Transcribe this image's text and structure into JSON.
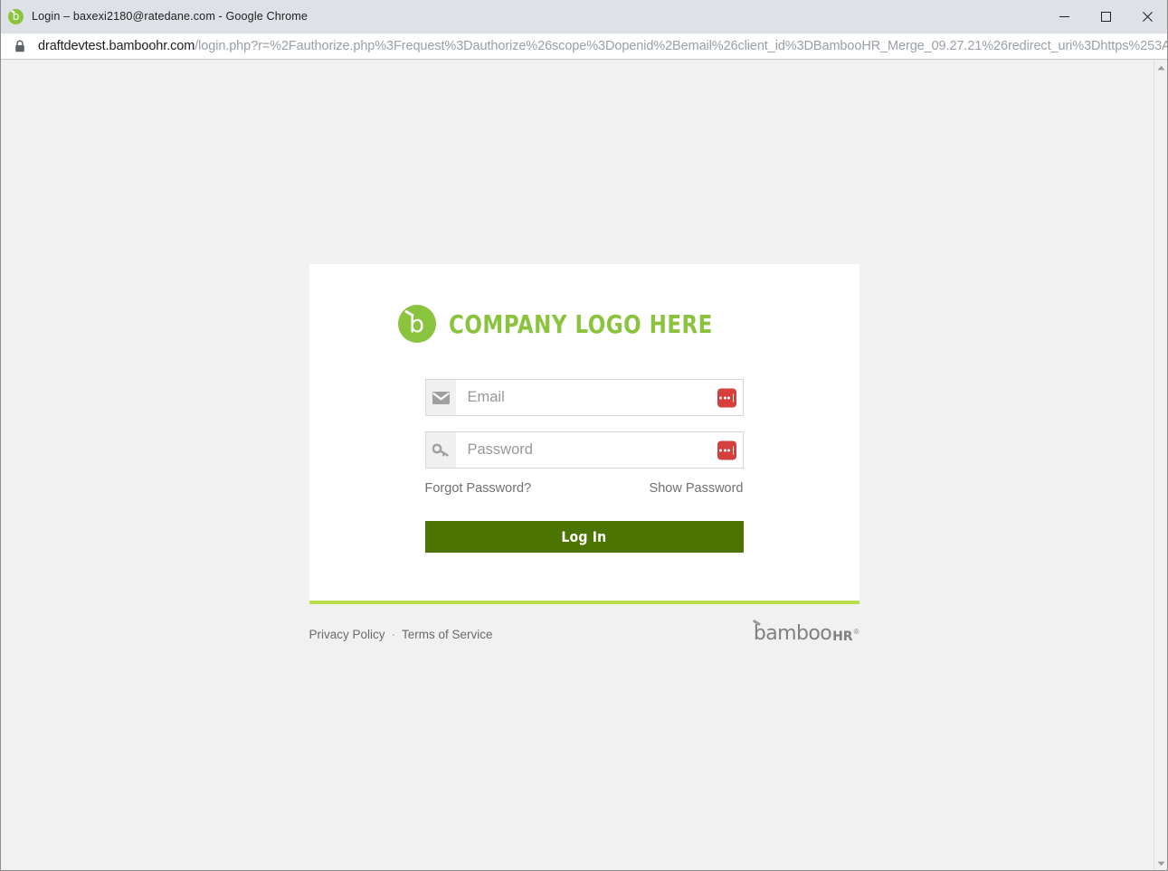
{
  "browser": {
    "window_title": "Login – baxexi2180@ratedane.com - Google Chrome",
    "favicon_name": "bamboohr-favicon",
    "minimize_label": "Minimize",
    "maximize_label": "Maximize",
    "close_label": "Close",
    "url_host": "draftdevtest.bamboohr.com",
    "url_path": "/login.php?r=%2Fauthorize.php%3Frequest%3Dauthorize%26scope%3Dopenid%2Bemail%26client_id%3DBambooHR_Merge_09.27.21%26redirect_uri%3Dhttps%253A%2...",
    "lock_icon": "lock-icon"
  },
  "login": {
    "logo_text": "COMPANY LOGO HERE",
    "email": {
      "placeholder": "Email",
      "value": "",
      "icon": "envelope-icon",
      "password_manager_badge": "1password-badge"
    },
    "password": {
      "placeholder": "Password",
      "value": "",
      "icon": "key-icon",
      "password_manager_badge": "1password-badge"
    },
    "forgot_password_label": "Forgot Password?",
    "show_password_label": "Show Password",
    "submit_label": "Log In"
  },
  "footer": {
    "privacy_policy_label": "Privacy Policy",
    "separator": "·",
    "terms_label": "Terms of Service",
    "brand_main": "bamboo",
    "brand_hr": "HR",
    "brand_reg": "®"
  },
  "scrollbar": {
    "up_arrow": "scroll-up-arrow",
    "down_arrow": "scroll-down-arrow"
  },
  "colors": {
    "brand_green": "#8ac43f",
    "accent_green_bar": "#b9dd4d",
    "button_green": "#4b7500",
    "page_bg": "#f1f1f1",
    "badge_red": "#d73f3f"
  }
}
